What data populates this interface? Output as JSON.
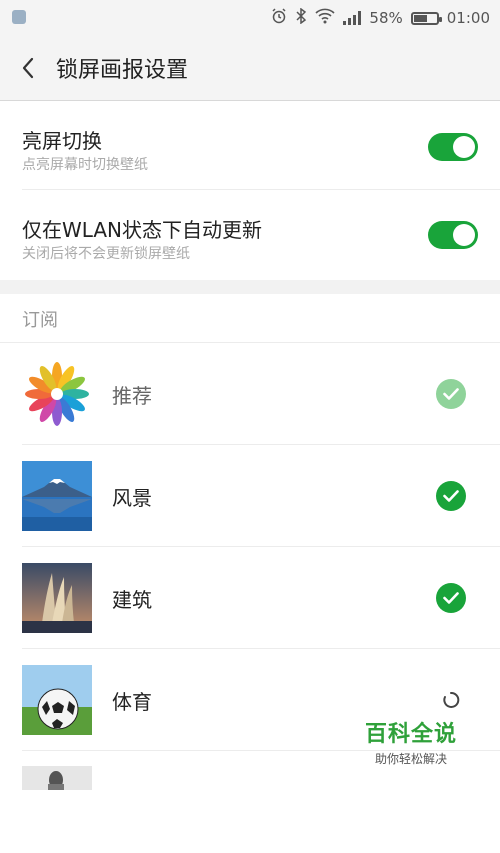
{
  "status_bar": {
    "battery": "58%",
    "battery_level": 0.58,
    "time": "01:00"
  },
  "header": {
    "title": "锁屏画报设置"
  },
  "settings": [
    {
      "label": "亮屏切换",
      "sub": "点亮屏幕时切换壁纸",
      "enabled": true
    },
    {
      "label": "仅在WLAN状态下自动更新",
      "sub": "关闭后将不会更新锁屏壁纸",
      "enabled": true
    }
  ],
  "subscriptions": {
    "title": "订阅",
    "items": [
      {
        "name": "推荐",
        "checked": true,
        "locked": true
      },
      {
        "name": "风景",
        "checked": true
      },
      {
        "name": "建筑",
        "checked": true
      },
      {
        "name": "体育",
        "checked": false
      }
    ]
  },
  "colors": {
    "accent": "#19a43a",
    "check_faded": "#8fd39a"
  },
  "watermark": {
    "title": "百科全说",
    "subtitle": "助你轻松解决"
  }
}
